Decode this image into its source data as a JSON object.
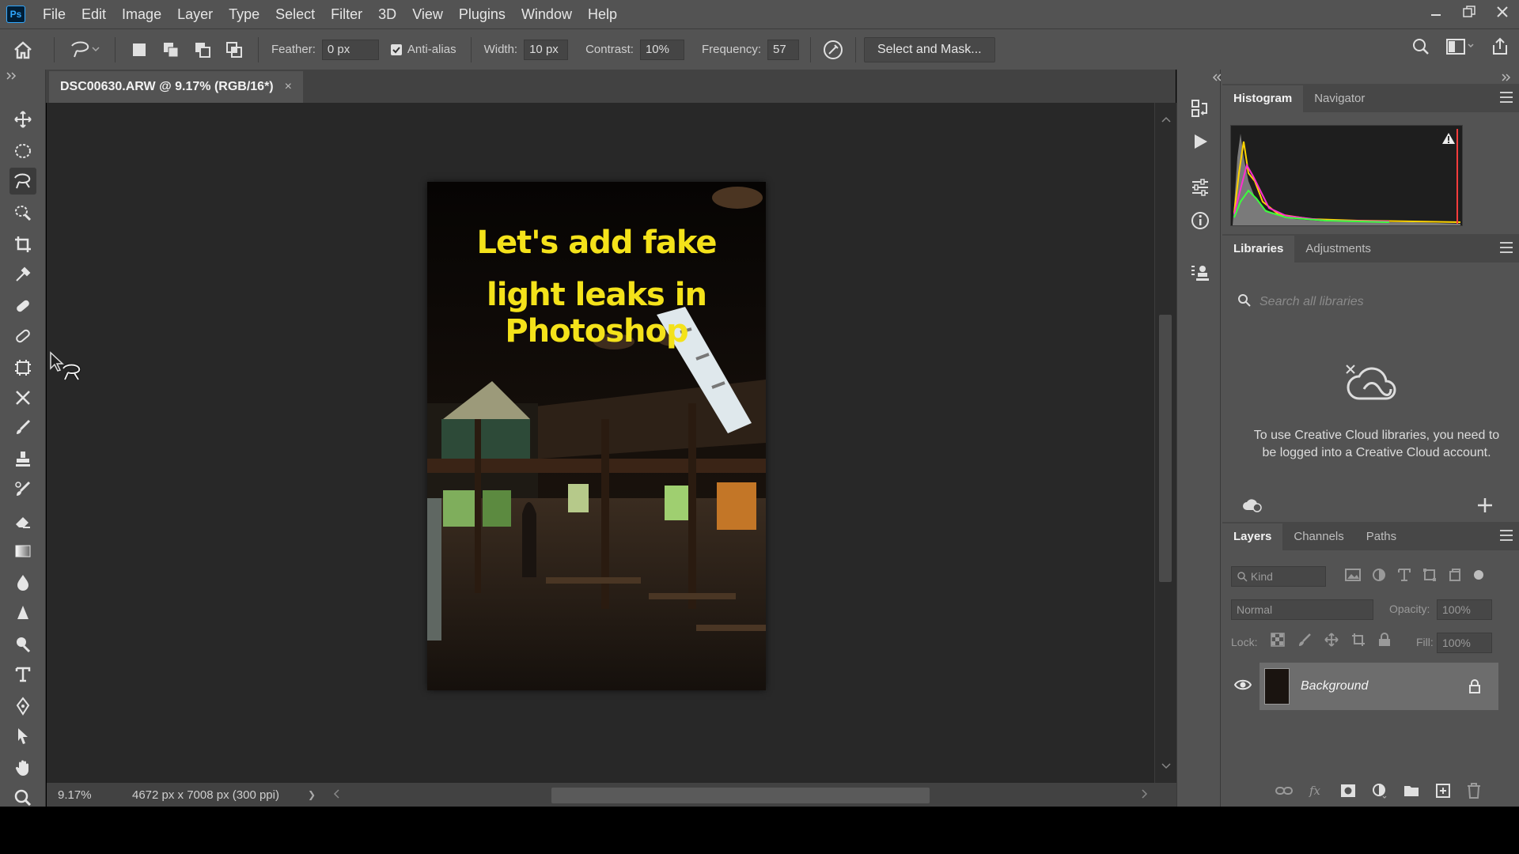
{
  "app": {
    "logo": "Ps"
  },
  "menu": [
    "File",
    "Edit",
    "Image",
    "Layer",
    "Type",
    "Select",
    "Filter",
    "3D",
    "View",
    "Plugins",
    "Window",
    "Help"
  ],
  "options": {
    "feather_label": "Feather:",
    "feather_value": "0 px",
    "antialias_label": "Anti-alias",
    "antialias_checked": true,
    "width_label": "Width:",
    "width_value": "10 px",
    "contrast_label": "Contrast:",
    "contrast_value": "10%",
    "frequency_label": "Frequency:",
    "frequency_value": "57",
    "select_mask_label": "Select and Mask..."
  },
  "document": {
    "tab_title": "DSC00630.ARW @ 9.17% (RGB/16*)",
    "close_glyph": "×",
    "title_line1": "Let's add fake",
    "title_line2": "light leaks in Photoshop"
  },
  "status": {
    "zoom": "9.17%",
    "dimensions": "4672 px x 7008 px (300 ppi)",
    "arrow": "❯"
  },
  "panels": {
    "top_tabs": [
      "Histogram",
      "Navigator"
    ],
    "mid_tabs": [
      "Libraries",
      "Adjustments"
    ],
    "bottom_tabs": [
      "Layers",
      "Channels",
      "Paths"
    ],
    "library_search_placeholder": "Search all libraries",
    "library_message": "To use Creative Cloud libraries, you need to be logged into a Creative Cloud account.",
    "layers_kind": "Kind",
    "blend_mode": "Normal",
    "opacity_label": "Opacity:",
    "opacity_value": "100%",
    "lock_label": "Lock:",
    "fill_label": "Fill:",
    "fill_value": "100%",
    "layer_name": "Background"
  },
  "colors": {
    "accent_blue": "#31a8ff",
    "title_yellow": "#f4e21a"
  }
}
